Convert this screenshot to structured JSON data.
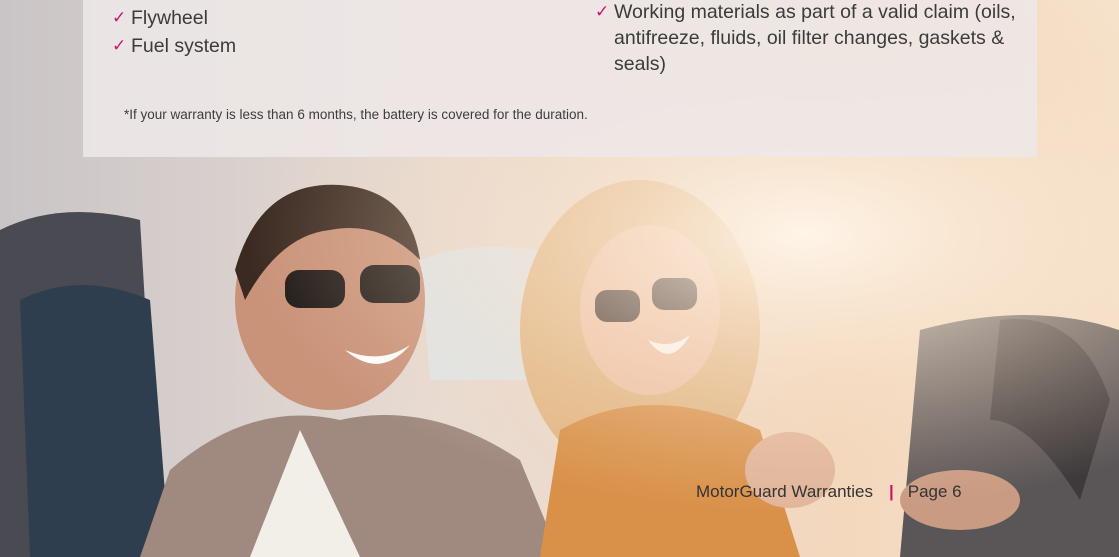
{
  "coverage_left": [
    {
      "label": "Flywheel"
    },
    {
      "label": "Fuel system"
    }
  ],
  "coverage_right": [
    {
      "label": "Working materials as part of a valid claim (oils, antifreeze, fluids, oil filter changes, gaskets & seals)"
    }
  ],
  "check_glyph": "✓",
  "footnote": "*If your warranty is less than 6 months, the battery is covered for the duration.",
  "footer": {
    "brand": "MotorGuard Warranties",
    "separator": "|",
    "page": "Page 6"
  },
  "colors": {
    "accent": "#c8176c",
    "panel": "#eee8e8",
    "text": "#3b3b3b"
  },
  "image": {
    "description_icon": "couple-in-car-photo"
  }
}
